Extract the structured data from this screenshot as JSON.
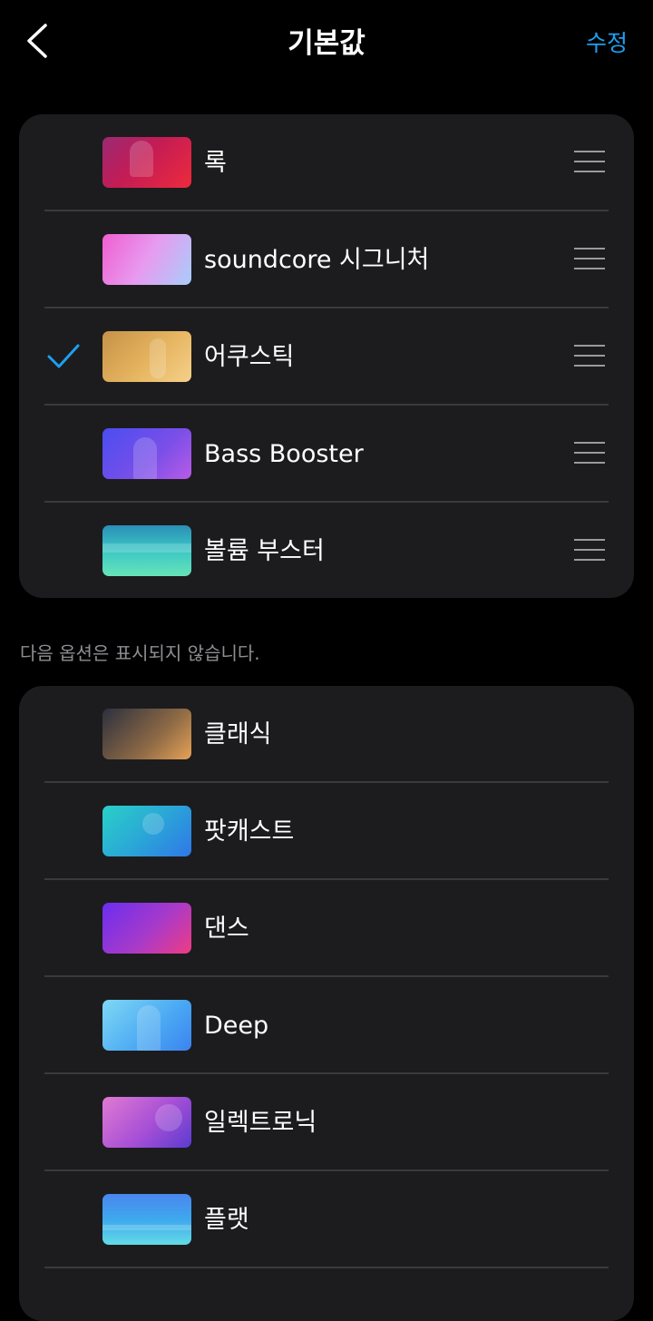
{
  "header": {
    "title": "기본값",
    "edit_label": "수정"
  },
  "active_presets": [
    {
      "label": "록",
      "thumb": "g-rock",
      "checked": false
    },
    {
      "label": "soundcore 시그니처",
      "thumb": "g-sig",
      "checked": false
    },
    {
      "label": "어쿠스틱",
      "thumb": "g-acoustic",
      "checked": true
    },
    {
      "label": "Bass Booster",
      "thumb": "g-bass",
      "checked": false
    },
    {
      "label": "볼륨 부스터",
      "thumb": "g-vol",
      "checked": false
    }
  ],
  "hidden_note": "다음 옵션은 표시되지 않습니다.",
  "hidden_presets": [
    {
      "label": "클래식",
      "thumb": "g-classic"
    },
    {
      "label": "팟캐스트",
      "thumb": "g-podcast"
    },
    {
      "label": "댄스",
      "thumb": "g-dance"
    },
    {
      "label": "Deep",
      "thumb": "g-deep"
    },
    {
      "label": "일렉트로닉",
      "thumb": "g-electro"
    },
    {
      "label": "플랫",
      "thumb": "g-flat"
    }
  ],
  "colors": {
    "accent": "#1e9ff2",
    "card_background": "#1c1c1e",
    "page_background": "#000000"
  },
  "icons": {
    "back": "chevron-left-icon",
    "check": "checkmark-icon",
    "drag": "drag-handle-icon"
  }
}
